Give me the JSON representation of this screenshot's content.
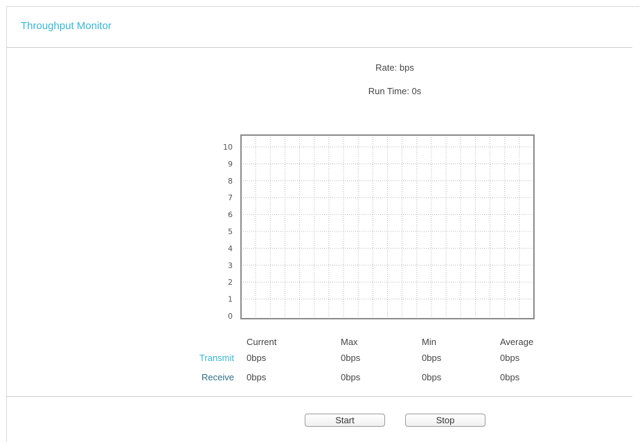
{
  "panel": {
    "title": "Throughput Monitor"
  },
  "stats": {
    "rate": "Rate: bps",
    "run_time": "Run Time: 0s"
  },
  "chart_data": {
    "type": "line",
    "title": "",
    "xlabel": "",
    "ylabel": "",
    "ylim": [
      0,
      10
    ],
    "y_ticks": [
      "0",
      "1",
      "2",
      "3",
      "4",
      "5",
      "6",
      "7",
      "8",
      "9",
      "10"
    ],
    "grid": true,
    "series": [
      {
        "values": []
      },
      {
        "values": []
      }
    ]
  },
  "table": {
    "columns": [
      "Current",
      "Max",
      "Min",
      "Average"
    ],
    "rows": [
      {
        "label": "Transmit",
        "values": [
          "0bps",
          "0bps",
          "0bps",
          "0bps"
        ]
      },
      {
        "label": "Receive",
        "values": [
          "0bps",
          "0bps",
          "0bps",
          "0bps"
        ]
      }
    ]
  },
  "buttons": {
    "start": "Start",
    "stop": "Stop"
  },
  "colors": {
    "accent": "#3ab5d3",
    "receive_label": "#2e6f86",
    "grid_border": "#8a8a8a"
  }
}
